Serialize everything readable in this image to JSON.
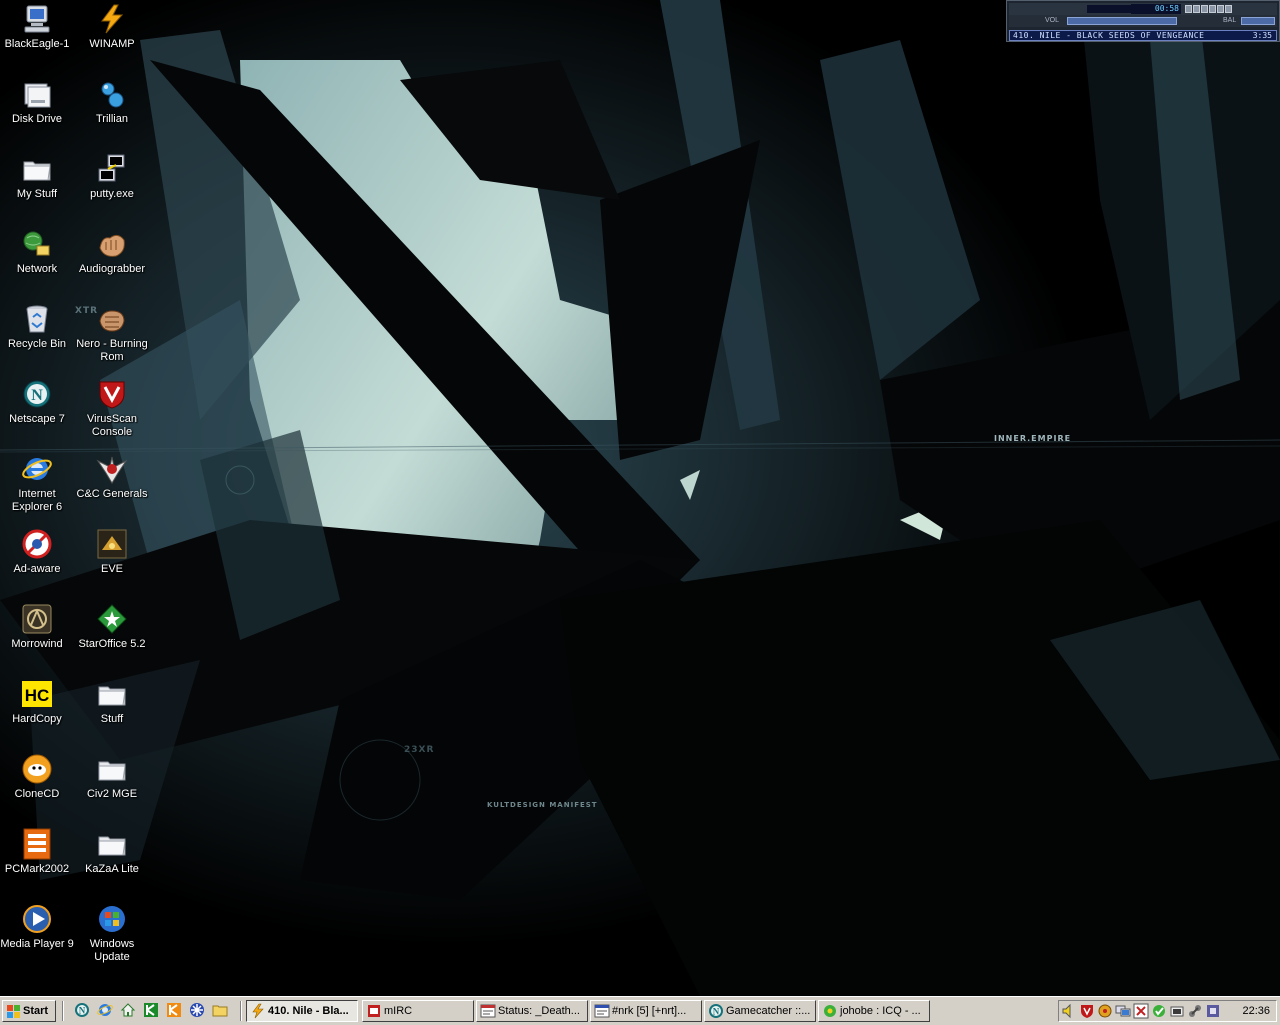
{
  "desktop": {
    "icons": [
      {
        "label": "BlackEagle-1",
        "icon": "my-computer-icon"
      },
      {
        "label": "Disk Drive",
        "icon": "disk-drive-icon"
      },
      {
        "label": "My Stuff",
        "icon": "folder-icon"
      },
      {
        "label": "Network",
        "icon": "network-icon"
      },
      {
        "label": "Recycle Bin",
        "icon": "recycle-bin-icon"
      },
      {
        "label": "Netscape 7",
        "icon": "netscape-icon"
      },
      {
        "label": "Internet Explorer 6",
        "icon": "internet-explorer-icon"
      },
      {
        "label": "Ad-aware",
        "icon": "ad-aware-icon"
      },
      {
        "label": "Morrowind",
        "icon": "morrowind-icon"
      },
      {
        "label": "HardCopy",
        "icon": "hardcopy-icon",
        "icon_text": "HC"
      },
      {
        "label": "CloneCD",
        "icon": "clonecd-icon"
      },
      {
        "label": "PCMark2002",
        "icon": "pcmark-icon"
      },
      {
        "label": "Media Player 9",
        "icon": "media-player-icon"
      },
      {
        "label": "WINAMP",
        "icon": "winamp-icon"
      },
      {
        "label": "Trillian",
        "icon": "trillian-icon"
      },
      {
        "label": "putty.exe",
        "icon": "putty-icon"
      },
      {
        "label": "Audiograbber",
        "icon": "audiograbber-icon"
      },
      {
        "label": "Nero - Burning Rom",
        "icon": "nero-icon"
      },
      {
        "label": "VirusScan Console",
        "icon": "virusscan-icon"
      },
      {
        "label": "C&C Generals",
        "icon": "cnc-generals-icon"
      },
      {
        "label": "EVE",
        "icon": "eve-icon"
      },
      {
        "label": "StarOffice 5.2",
        "icon": "staroffice-icon"
      },
      {
        "label": "Stuff",
        "icon": "folder-icon"
      },
      {
        "label": "Civ2 MGE",
        "icon": "folder-icon"
      },
      {
        "label": "KaZaA Lite",
        "icon": "folder-icon"
      },
      {
        "label": "Windows Update",
        "icon": "windows-update-icon"
      }
    ],
    "wallpaper_texts": {
      "inner_empire": "INNER.EMPIRE",
      "kultdesign": "KULTDESIGN MANIFEST",
      "xtr": "XTR",
      "n23": "23XR"
    }
  },
  "winamp": {
    "elapsed": "00:58",
    "vol_label": "VOL",
    "bal_label": "BAL",
    "song_title": "410. NILE - BLACK SEEDS OF VENGEANCE",
    "song_length": "3:35"
  },
  "taskbar": {
    "start_label": "Start",
    "quick_launch": [
      "netscape-icon",
      "internet-explorer-icon",
      "show-desktop-icon",
      "kazaa-icon",
      "kazaa-lite-icon",
      "trillian-icon",
      "folder-icon"
    ],
    "tasks": [
      {
        "label": "410. Nile - Bla...",
        "icon": "winamp-icon",
        "active": true
      },
      {
        "label": "mIRC",
        "icon": "mirc-icon",
        "active": false
      },
      {
        "label": "Status: _Death...",
        "icon": "status-window-icon",
        "active": false
      },
      {
        "label": "#nrk [5] [+nrt]...",
        "icon": "channel-window-icon",
        "active": false
      },
      {
        "label": "Gamecatcher ::...",
        "icon": "netscape-icon",
        "active": false
      },
      {
        "label": "johobe : ICQ - ...",
        "icon": "icq-icon",
        "active": false
      }
    ],
    "tray_icons": [
      "volume-icon",
      "virusscan-tray-icon",
      "tray-app-icon",
      "network-tray-icon",
      "tray-close-icon",
      "icq-tray-icon",
      "tray-app2-icon",
      "tray-connection-icon",
      "tray-app3-icon"
    ],
    "clock": "22:36"
  },
  "colors": {
    "taskbar": "#d4d0c8",
    "wallpaper_accent": "#a9c8c4"
  }
}
